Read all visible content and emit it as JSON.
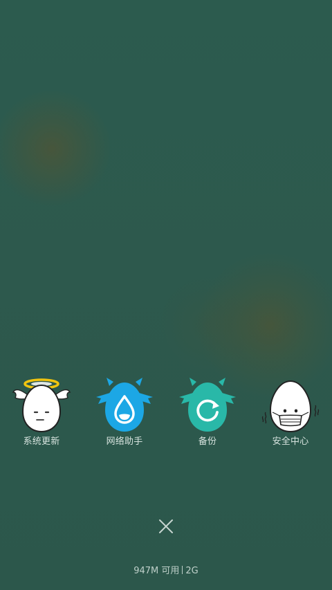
{
  "shortcuts": [
    {
      "label": "系统更新",
      "icon": "angel-egg-icon"
    },
    {
      "label": "网络助手",
      "icon": "water-drop-monster-icon"
    },
    {
      "label": "备份",
      "icon": "refresh-monster-icon"
    },
    {
      "label": "安全中心",
      "icon": "masked-egg-icon"
    }
  ],
  "memory": {
    "available": "947M 可用",
    "total": "2G"
  },
  "colors": {
    "background": "#2c5a4d",
    "label": "#d7e4df",
    "network_blue": "#1ca7e5",
    "backup_teal": "#29b8a8",
    "halo_yellow": "#f1c40f"
  }
}
